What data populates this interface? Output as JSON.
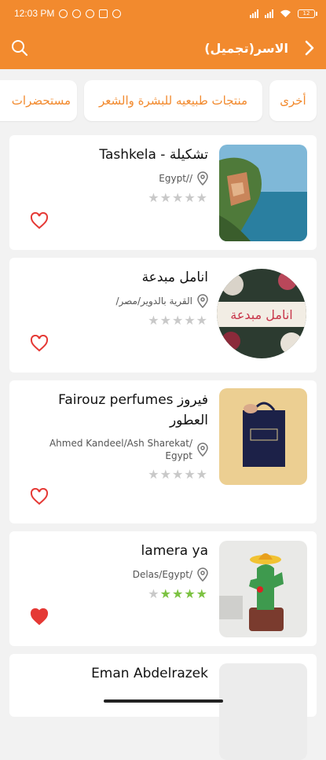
{
  "status": {
    "time": "12:03 PM",
    "battery": "12"
  },
  "header": {
    "title": "الاسر(تجميل)"
  },
  "tabs": [
    "أخرى",
    "منتجات طبيعيه للبشرة والشعر",
    "مستحضرات"
  ],
  "stores": [
    {
      "name": "Tashkela - تشكيلة",
      "location": "Egypt//",
      "rating": 0,
      "favorite": false
    },
    {
      "name": "انامل مبدعة",
      "location": "/القرية بالدوير/مصر",
      "rating": 0,
      "favorite": false
    },
    {
      "name_line1": "Fairouz perfumes فيروز",
      "name_line2": "العطور",
      "location_line1": "Ahmed Kandeel/Ash Sharekat/",
      "location_line2": "Egypt",
      "rating": 0,
      "favorite": false
    },
    {
      "name": "lamera ya",
      "location": "Delas/Egypt/",
      "rating": 4,
      "favorite": true
    },
    {
      "name": "Eman Abdelrazek"
    }
  ],
  "thumb_text": {
    "store2": "انامل مبدعة"
  },
  "colors": {
    "accent": "#f28a2e",
    "star_on": "#7cc242",
    "star_off": "#c9c9c9",
    "heart": "#e53935"
  },
  "icons": {
    "search": "search-icon",
    "back": "chevron-right-icon",
    "pin": "location-pin-icon",
    "heart": "heart-icon",
    "star": "star-icon"
  }
}
